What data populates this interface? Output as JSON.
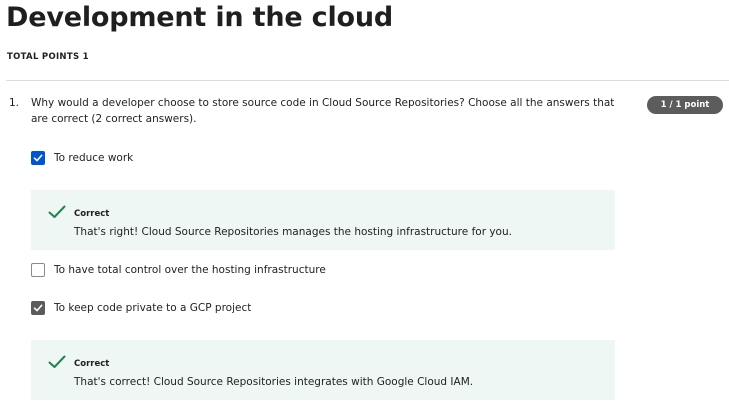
{
  "page": {
    "title": "Development in the cloud",
    "total_points": "TOTAL POINTS 1"
  },
  "question": {
    "number": "1.",
    "text": "Why would a developer choose to store source code in Cloud Source Repositories? Choose all the answers that are correct (2 correct answers).",
    "points_badge": "1 / 1 point",
    "options": [
      {
        "label": "To reduce work",
        "checked": true,
        "check_color": "#0056d2"
      },
      {
        "label": "To have total control over the hosting infrastructure",
        "checked": false
      },
      {
        "label": "To keep code private to a GCP project",
        "checked": true,
        "check_color": "#5c5c5c"
      }
    ],
    "feedback": [
      {
        "title": "Correct",
        "text": "That's right! Cloud Source Repositories manages the hosting infrastructure for you.",
        "icon": "checkmark-icon"
      },
      {
        "title": "Correct",
        "text": "That's correct! Cloud Source Repositories integrates with Google Cloud IAM.",
        "icon": "checkmark-icon"
      }
    ]
  },
  "colors": {
    "accent": "#0056d2",
    "success": "#1f8354",
    "feedback_bg": "#eef7f3",
    "badge_bg": "#5c5c5c"
  }
}
